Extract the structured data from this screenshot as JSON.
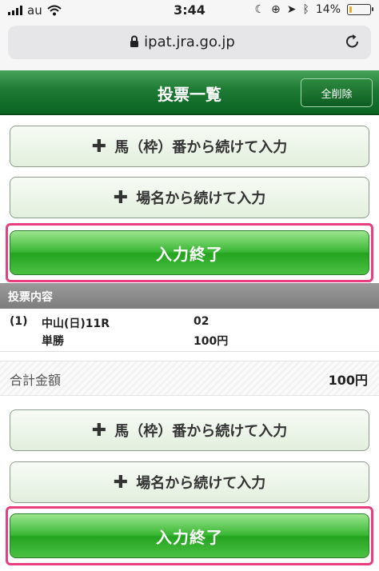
{
  "status_bar": {
    "carrier": "au",
    "time": "3:44",
    "battery_percent": "14%",
    "battery_level": 0.14,
    "battery_color": "#e9a92a"
  },
  "browser": {
    "url": "ipat.jra.go.jp"
  },
  "header": {
    "title": "投票一覧",
    "clear_all_label": "全削除"
  },
  "actions_top": {
    "horse_number_continue": "馬（枠）番から続けて入力",
    "venue_continue": "場名から続けて入力",
    "finish_input": "入力終了"
  },
  "bet_list": {
    "section_title": "投票内容",
    "items": [
      {
        "index": "(1)",
        "race": "中山(日)11R",
        "selection": "02",
        "bet_type": "単勝",
        "amount": "100円"
      }
    ]
  },
  "total": {
    "label": "合計金額",
    "amount": "100円"
  },
  "actions_bottom": {
    "horse_number_continue": "馬（枠）番から続けて入力",
    "venue_continue": "場名から続けて入力",
    "finish_input": "入力終了"
  },
  "colors": {
    "header_green": "#0a6323",
    "finish_green": "#39b633",
    "highlight_frame": "#e83e7e"
  }
}
